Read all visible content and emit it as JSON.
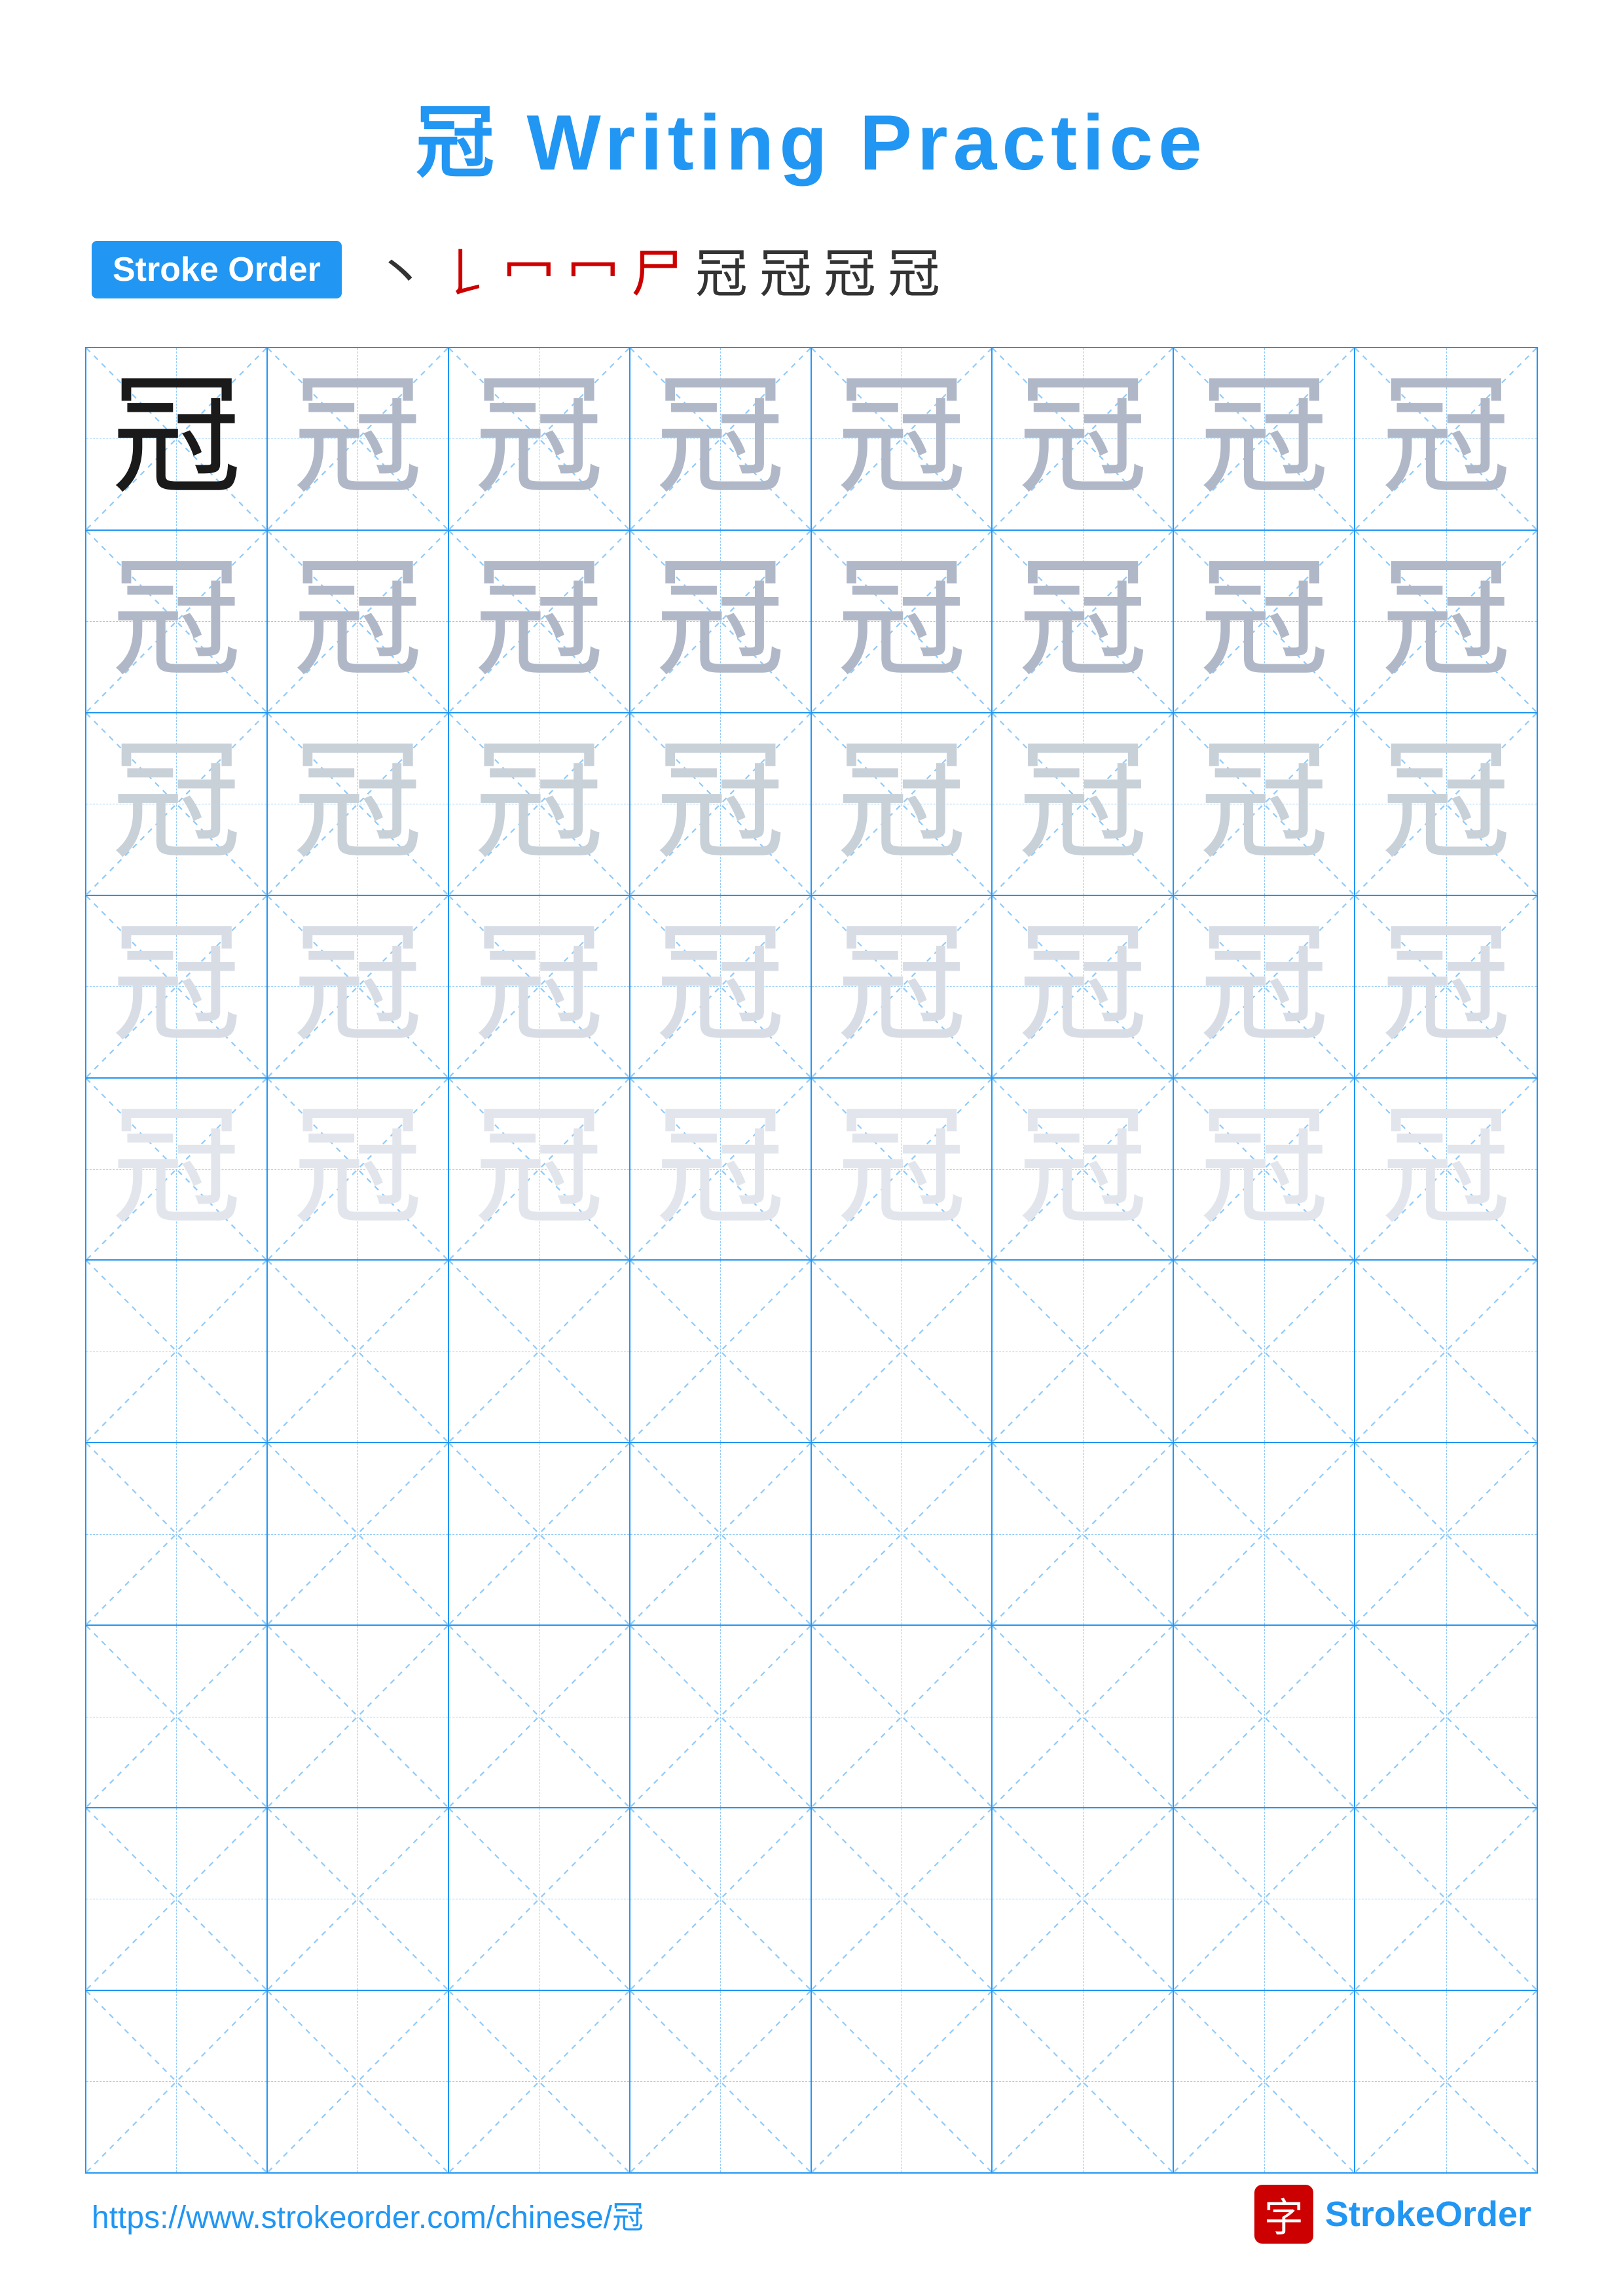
{
  "title": "冠 Writing Practice",
  "title_char": "冠",
  "title_text": " Writing Practice",
  "stroke_order_label": "Stroke Order",
  "stroke_chars": [
    "丶",
    "𠄌",
    "冖",
    "冖",
    "尸",
    "冠",
    "冠",
    "冠",
    "冠"
  ],
  "practice_char": "冠",
  "rows": 10,
  "cols": 8,
  "footer_url": "https://www.strokeorder.com/chinese/冠",
  "footer_logo_char": "字",
  "footer_logo_text": "StrokeOrder",
  "colors": {
    "blue": "#2196F3",
    "light_blue": "#90CAF9",
    "red": "#cc0000"
  },
  "char_rows": [
    [
      "dark",
      "light-1",
      "light-1",
      "light-1",
      "light-1",
      "light-1",
      "light-1",
      "light-1"
    ],
    [
      "light-1",
      "light-1",
      "light-1",
      "light-1",
      "light-1",
      "light-1",
      "light-1",
      "light-1"
    ],
    [
      "light-2",
      "light-2",
      "light-2",
      "light-2",
      "light-2",
      "light-2",
      "light-2",
      "light-2"
    ],
    [
      "light-3",
      "light-3",
      "light-3",
      "light-3",
      "light-3",
      "light-3",
      "light-3",
      "light-3"
    ],
    [
      "light-4",
      "light-4",
      "light-4",
      "light-4",
      "light-4",
      "light-4",
      "light-4",
      "light-4"
    ],
    [
      "empty",
      "empty",
      "empty",
      "empty",
      "empty",
      "empty",
      "empty",
      "empty"
    ],
    [
      "empty",
      "empty",
      "empty",
      "empty",
      "empty",
      "empty",
      "empty",
      "empty"
    ],
    [
      "empty",
      "empty",
      "empty",
      "empty",
      "empty",
      "empty",
      "empty",
      "empty"
    ],
    [
      "empty",
      "empty",
      "empty",
      "empty",
      "empty",
      "empty",
      "empty",
      "empty"
    ],
    [
      "empty",
      "empty",
      "empty",
      "empty",
      "empty",
      "empty",
      "empty",
      "empty"
    ]
  ]
}
